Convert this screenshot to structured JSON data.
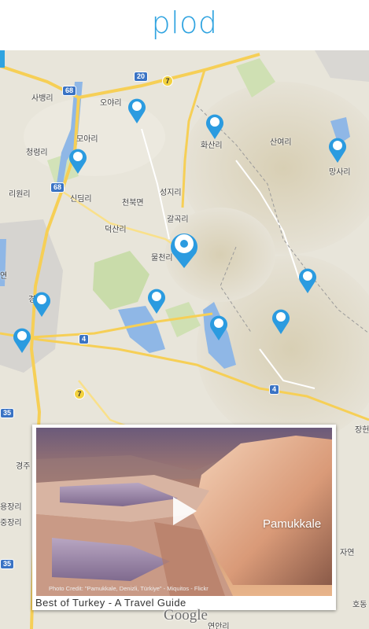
{
  "app": {
    "logo": "plod"
  },
  "map": {
    "places": [
      "사뱅리",
      "오야리",
      "화산리",
      "산여리",
      "망사리",
      "모아리",
      "청령리",
      "리원리",
      "신딤리",
      "천북면",
      "성지리",
      "덕산리",
      "갈곡리",
      "물천리",
      "경",
      "경주",
      "장헌",
      "용장리",
      "중장리",
      "자연",
      "연",
      "호동",
      "연안리"
    ],
    "shields": [
      "68",
      "68",
      "20",
      "7",
      "7",
      "4",
      "4",
      "35",
      "35"
    ],
    "attribution": "Google"
  },
  "colors": {
    "accent": "#2fa3e0",
    "pin": "#2b9be0"
  },
  "video_card": {
    "overlay_text": "Pamukkale",
    "credit": "Photo Credit: \"Pamukkale, Denizli, Türkiye\" - Miquitos - Flickr",
    "title": "Best of Turkey - A Travel Guide"
  }
}
